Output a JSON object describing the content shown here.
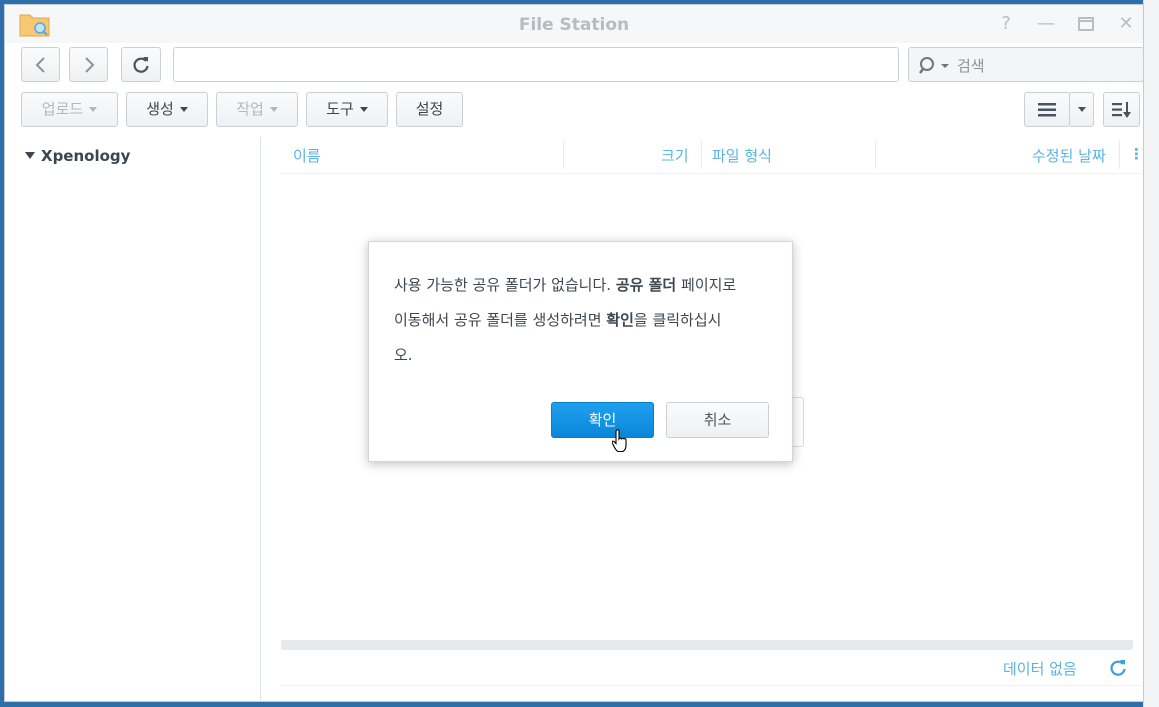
{
  "window": {
    "title": "File Station",
    "controls": [
      "help",
      "minimize",
      "maximize",
      "close"
    ]
  },
  "toolbar": {
    "search_placeholder": "검색",
    "path_value": "",
    "upload_label": "업로드",
    "create_label": "생성",
    "action_label": "작업",
    "tools_label": "도구",
    "settings_label": "설정"
  },
  "sidebar": {
    "items": [
      {
        "label": "Xpenology",
        "expanded": true
      }
    ]
  },
  "file_list": {
    "columns": [
      "이름",
      "크기",
      "파일 형식",
      "수정된 날짜"
    ],
    "status": "데이터 없음"
  },
  "dialog": {
    "line1_a": "사용 가능한 공유 폴더가 없습니다. ",
    "line1_bold": "공유 폴더",
    "line1_b": " 페이지로",
    "line2_a": "이동해서 공유 폴더를 생성하려면 ",
    "line2_bold": "확인",
    "line2_b": "을 클릭하십시",
    "line3": "오.",
    "ok_label": "확인",
    "cancel_label": "취소"
  },
  "colors": {
    "accent": "#0a86d8",
    "column_header": "#5bb4e5"
  }
}
